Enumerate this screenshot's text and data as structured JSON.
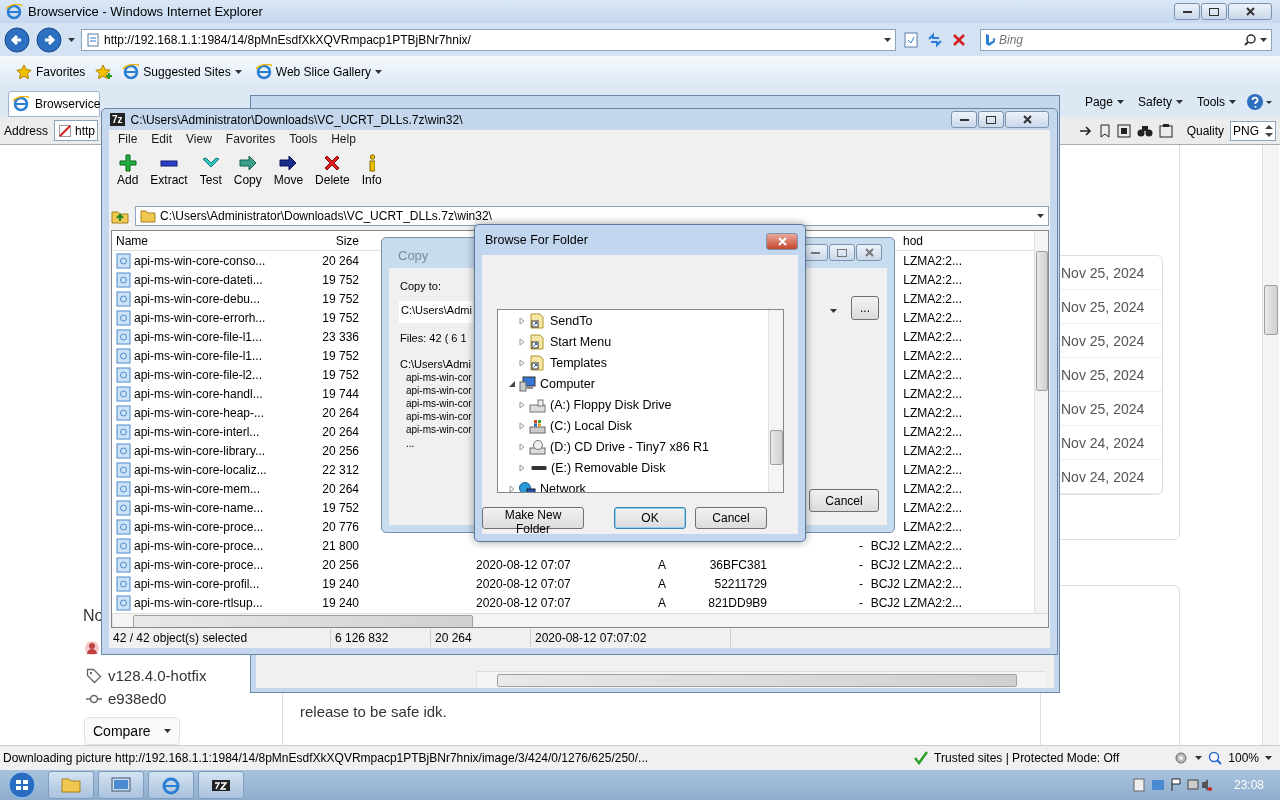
{
  "ie": {
    "title": "Browservice - Windows Internet Explorer",
    "url": "http://192.168.1.1:1984/14/8pMnEsdfXkXQVRmpacp1PTBjBNr7hnix/",
    "search_placeholder": "Bing",
    "favorites_label": "Favorites",
    "favorite_links": [
      "Suggested Sites",
      "Web Slice Gallery"
    ],
    "tab": "Browservice",
    "commands": [
      "Page",
      "Safety",
      "Tools"
    ],
    "address_label": "Address",
    "address_value": "http",
    "quality_label": "Quality",
    "quality_value": "PNG",
    "status_text": "Downloading picture http://192.168.1.1:1984/14/8pMnEsdfXkXQVRmpacp1PTBjBNr7hnix/image/3/424/0/1276/625/250/...",
    "zone": "Trusted sites | Protected Mode: Off",
    "zoom": "100%"
  },
  "page": {
    "heading": "No",
    "tag": "v128.4.0-hotfix",
    "commit": "e938ed0",
    "compare": "Compare",
    "comment": "release to be safe idk.",
    "dates": [
      "Nov 25, 2024",
      "Nov 25, 2024",
      "Nov 25, 2024",
      "Nov 25, 2024",
      "Nov 25, 2024",
      "Nov 24, 2024",
      "Nov 24, 2024"
    ]
  },
  "sevenzip": {
    "logo": "7z",
    "title": "C:\\Users\\Administrator\\Downloads\\VC_UCRT_DLLs.7z\\win32\\",
    "menu": [
      "File",
      "Edit",
      "View",
      "Favorites",
      "Tools",
      "Help"
    ],
    "tools": [
      {
        "kind": "add",
        "label": "Add"
      },
      {
        "kind": "extract",
        "label": "Extract"
      },
      {
        "kind": "test",
        "label": "Test"
      },
      {
        "kind": "copy",
        "label": "Copy"
      },
      {
        "kind": "move",
        "label": "Move"
      },
      {
        "kind": "delete",
        "label": "Delete"
      },
      {
        "kind": "info",
        "label": "Info"
      }
    ],
    "path": "C:\\Users\\Administrator\\Downloads\\VC_UCRT_DLLs.7z\\win32\\",
    "columns": [
      "Name",
      "Size",
      "hod"
    ],
    "rows": [
      {
        "name": "api-ms-win-core-conso...",
        "size": "20 264",
        "method": "LZMA2:2..."
      },
      {
        "name": "api-ms-win-core-dateti...",
        "size": "19 752",
        "method": "LZMA2:2..."
      },
      {
        "name": "api-ms-win-core-debu...",
        "size": "19 752",
        "method": "LZMA2:2..."
      },
      {
        "name": "api-ms-win-core-errorh...",
        "size": "19 752",
        "method": "LZMA2:2..."
      },
      {
        "name": "api-ms-win-core-file-l1...",
        "size": "23 336",
        "method": "LZMA2:2..."
      },
      {
        "name": "api-ms-win-core-file-l1...",
        "size": "19 752",
        "method": "LZMA2:2..."
      },
      {
        "name": "api-ms-win-core-file-l2...",
        "size": "19 752",
        "method": "LZMA2:2..."
      },
      {
        "name": "api-ms-win-core-handl...",
        "size": "19 744",
        "method": "LZMA2:2..."
      },
      {
        "name": "api-ms-win-core-heap-...",
        "size": "20 264",
        "method": "LZMA2:2..."
      },
      {
        "name": "api-ms-win-core-interl...",
        "size": "20 264",
        "method": "LZMA2:2..."
      },
      {
        "name": "api-ms-win-core-library...",
        "size": "20 256",
        "method": "LZMA2:2..."
      },
      {
        "name": "api-ms-win-core-localiz...",
        "size": "22 312",
        "method": "LZMA2:2..."
      },
      {
        "name": "api-ms-win-core-mem...",
        "size": "20 264",
        "method": "LZMA2:2..."
      },
      {
        "name": "api-ms-win-core-name...",
        "size": "19 752",
        "method": "LZMA2:2..."
      },
      {
        "name": "api-ms-win-core-proce...",
        "size": "20 776",
        "method": "LZMA2:2..."
      },
      {
        "name": "api-ms-win-core-proce...",
        "size": "21 800",
        "encrypted": "-",
        "method": "BCJ2 LZMA2:2..."
      },
      {
        "name": "api-ms-win-core-proce...",
        "size": "20 256",
        "modified": "2020-08-12 07:07",
        "attributes": "A",
        "crc": "36BFC381",
        "encrypted": "-",
        "method": "BCJ2 LZMA2:2..."
      },
      {
        "name": "api-ms-win-core-profil...",
        "size": "19 240",
        "modified": "2020-08-12 07:07",
        "attributes": "A",
        "crc": "52211729",
        "encrypted": "-",
        "method": "BCJ2 LZMA2:2..."
      },
      {
        "name": "api-ms-win-core-rtlsup...",
        "size": "19 240",
        "modified": "2020-08-12 07:07",
        "attributes": "A",
        "crc": "821DD9B9",
        "encrypted": "-",
        "method": "BCJ2 LZMA2:2..."
      }
    ],
    "status": [
      "42 / 42 object(s) selected",
      "6 126 832",
      "20 264",
      "2020-08-12 07:07:02"
    ]
  },
  "copy_dialog": {
    "title": "Copy",
    "copy_to_label": "Copy to:",
    "copy_to_value": "C:\\Users\\Admi",
    "files": "Files: 42 ( 6 1",
    "path": "C:\\Users\\Admi",
    "list": [
      "api-ms-win-cor",
      "api-ms-win-cor",
      "api-ms-win-cor",
      "api-ms-win-cor",
      "api-ms-win-cor"
    ],
    "more": "...",
    "browse_button": "...",
    "cancel": "Cancel"
  },
  "browse_dialog": {
    "title": "Browse For Folder",
    "tree": {
      "continued": [
        {
          "label": "SendTo",
          "kind": "shortcut",
          "expanded": false
        },
        {
          "label": "Start Menu",
          "kind": "shortcut",
          "expanded": false
        },
        {
          "label": "Templates",
          "kind": "shortcut",
          "expanded": false
        }
      ],
      "items": [
        {
          "label": "Computer",
          "kind": "computer",
          "expanded": true,
          "children": [
            {
              "label": "(A:) Floppy Disk Drive",
              "kind": "floppy",
              "expanded": false
            },
            {
              "label": "(C:) Local Disk",
              "kind": "disk",
              "expanded": false
            },
            {
              "label": "(D:) CD Drive - Tiny7 x86 R1",
              "kind": "cd",
              "expanded": false
            },
            {
              "label": "(E:) Removable Disk",
              "kind": "removable",
              "expanded": false
            }
          ]
        },
        {
          "label": "Network",
          "kind": "network",
          "expanded": false
        }
      ]
    },
    "buttons": [
      {
        "label": "Make New Folder",
        "default": false
      },
      {
        "label": "OK",
        "default": true
      },
      {
        "label": "Cancel",
        "default": false
      }
    ]
  },
  "taskbar": {
    "clock": "23:08"
  }
}
